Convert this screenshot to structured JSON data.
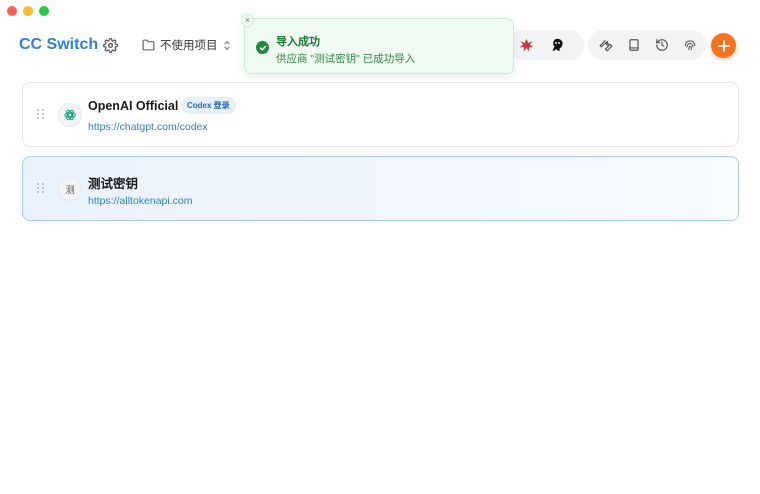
{
  "app": {
    "title": "CC Switch"
  },
  "project": {
    "label": "不使用项目"
  },
  "toast": {
    "title": "导入成功",
    "message": "供应商 \"测试密钥\" 已成功导入",
    "close_glyph": "×"
  },
  "colors": {
    "accent": "#2f7fe0",
    "add_button": "#f5731f",
    "success": "#1f8a3b"
  },
  "toolbar": {
    "apps": [
      "claude-icon",
      "codex-icon"
    ],
    "tools": [
      "wrench-icon",
      "book-icon",
      "history-icon",
      "fingerprint-icon"
    ],
    "add_glyph": "+"
  },
  "providers": [
    {
      "name": "OpenAI Official",
      "badge": "Codex 登录",
      "url": "https://chatgpt.com/codex",
      "icon": "openai-icon",
      "active": false
    },
    {
      "name": "测试密钥",
      "icon_text": "测",
      "url": "https://alltokenapi.com",
      "active": true
    }
  ]
}
